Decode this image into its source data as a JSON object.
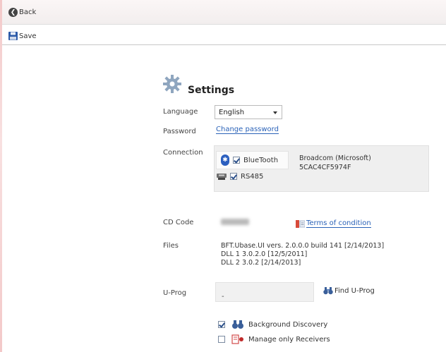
{
  "toolbar": {
    "back_label": "Back",
    "save_label": "Save"
  },
  "settings": {
    "title": "Settings",
    "language": {
      "label": "Language",
      "selected": "English"
    },
    "password": {
      "label": "Password",
      "link": "Change password"
    },
    "connection": {
      "label": "Connection",
      "bluetooth": {
        "label": "BlueTooth",
        "checked": true
      },
      "rs485": {
        "label": "RS485",
        "checked": true
      },
      "adapter_name": "Broadcom (Microsoft)",
      "adapter_address": "5CAC4CF5974F"
    },
    "cd_code": {
      "label": "CD Code",
      "terms_link": "Terms of condition"
    },
    "files": {
      "label": "Files",
      "lines": [
        "BFT.Ubase.UI vers. 2.0.0.0 build 141 [2/14/2013]",
        "DLL 1 3.0.2.0 [12/5/2011]",
        "DLL 2 3.0.2 [2/14/2013]"
      ]
    },
    "uprog": {
      "label": "U-Prog",
      "value": "-",
      "find_label": "Find U-Prog"
    },
    "options": [
      {
        "label": "Background Discovery",
        "checked": true
      },
      {
        "label": "Manage only Receivers",
        "checked": false
      }
    ]
  },
  "colors": {
    "link": "#2a62b8",
    "bluetooth": "#2b5fbf",
    "left_edge": "#f3c9c9"
  }
}
